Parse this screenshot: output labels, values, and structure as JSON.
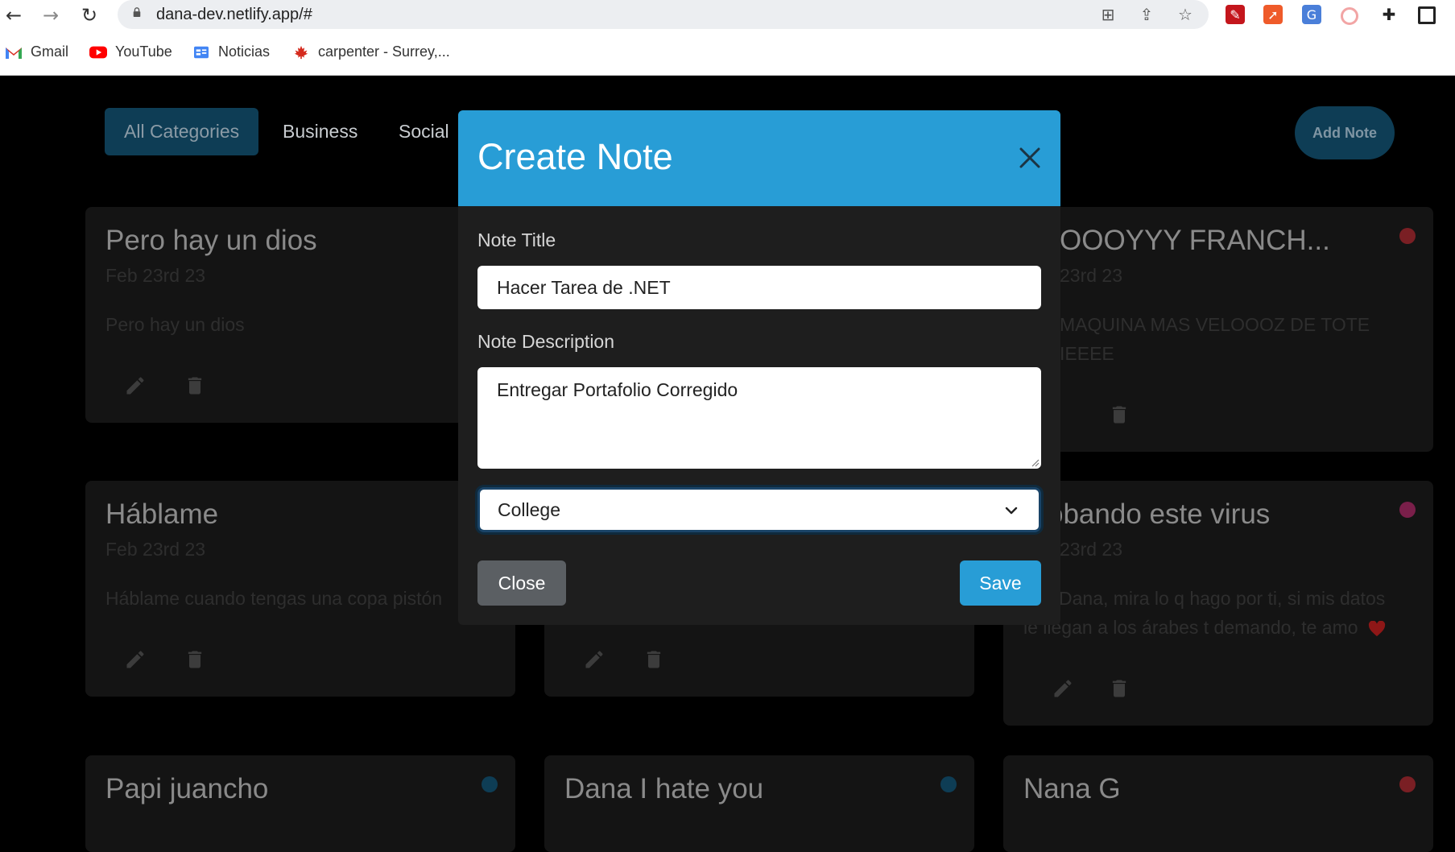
{
  "browser": {
    "url": "dana-dev.netlify.app/#",
    "bookmarks": [
      {
        "label": "Gmail"
      },
      {
        "label": "YouTube"
      },
      {
        "label": "Noticias"
      },
      {
        "label": "carpenter - Surrey,..."
      }
    ]
  },
  "page": {
    "tabs": [
      "All Categories",
      "Business",
      "Social"
    ],
    "add_note_label": "Add Note",
    "cards": [
      {
        "title": "Pero hay un dios",
        "date": "Feb 23rd 23",
        "description": "Pero hay un dios"
      },
      {
        "title": "OOOYYY FRANCH...",
        "date": "23rd 23",
        "description": "MAQUINA MAS VELOOOZ DE TOTE",
        "description2": "IEEEE",
        "dot_color": "#7a1f24"
      },
      {
        "title": "Háblame",
        "date": "Feb 23rd 23",
        "description": "Háblame cuando tengas una copa pistón"
      },
      {
        "title": "obando este virus",
        "date": "23rd 23",
        "description": "Dana, mira lo q hago por ti, si mis datos",
        "description2": "le llegan a los árabes t demando, te amo",
        "dot_color": "#7a1f4a"
      },
      {
        "title": "Papi juancho",
        "dot_color": "#0e3d55"
      },
      {
        "title": "Dana I hate you",
        "dot_color": "#0e3d55"
      },
      {
        "title": "Nana G",
        "dot_color": "#7a1f24"
      }
    ]
  },
  "modal": {
    "title": "Create Note",
    "note_title_label": "Note Title",
    "note_title_value": "Hacer Tarea de .NET",
    "note_description_label": "Note Description",
    "note_description_value": "Entregar Portafolio Corregido",
    "category_value": "College",
    "close_label": "Close",
    "save_label": "Save"
  }
}
